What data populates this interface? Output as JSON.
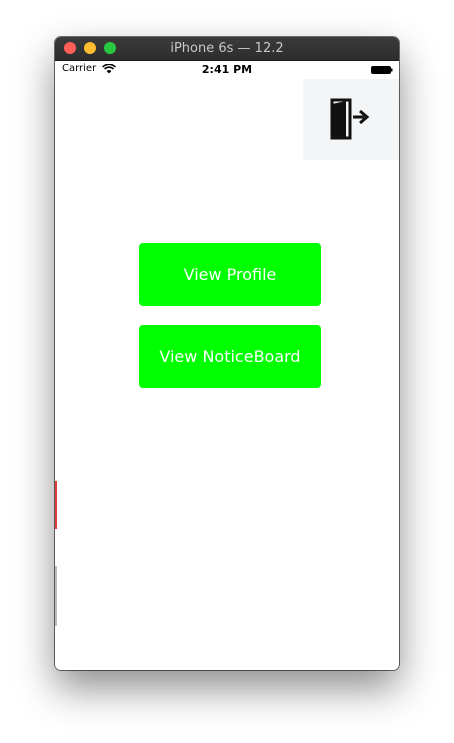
{
  "window": {
    "title": "iPhone 6s — 12.2"
  },
  "statusbar": {
    "carrier": "Carrier",
    "time": "2:41 PM",
    "wifi_icon": "wifi-icon",
    "battery_icon": "battery-icon"
  },
  "logout": {
    "icon": "logout-door-icon"
  },
  "main": {
    "view_profile_label": "View Profile",
    "view_noticeboard_label": "View NoticeBoard"
  },
  "colors": {
    "button_bg": "#00ff00",
    "button_text": "#ffffff",
    "titlebar": "#2d2d2d"
  }
}
